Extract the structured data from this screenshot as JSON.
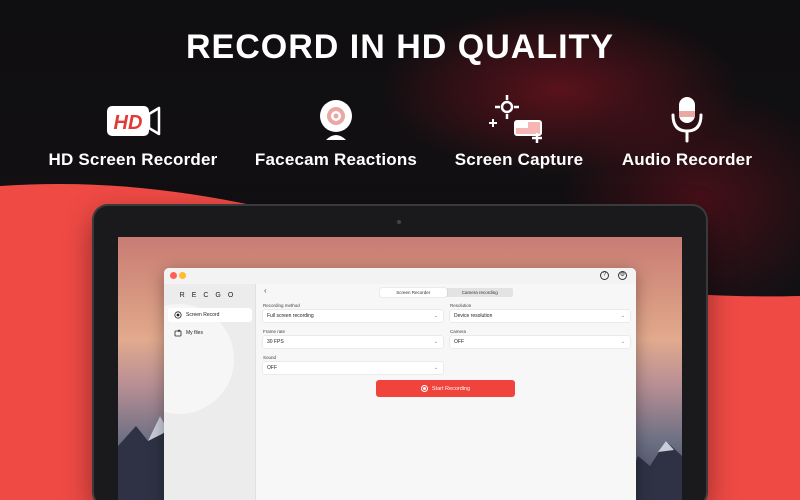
{
  "headline": "RECORD IN HD QUALITY",
  "features": [
    {
      "label": "HD Screen Recorder",
      "icon": "hd-camera-icon"
    },
    {
      "label": "Facecam Reactions",
      "icon": "webcam-icon"
    },
    {
      "label": "Screen Capture",
      "icon": "screen-capture-icon"
    },
    {
      "label": "Audio Recorder",
      "icon": "microphone-icon"
    }
  ],
  "hd_icon_text": "HD",
  "colors": {
    "accent": "#f0433b",
    "background": "#111111",
    "accent_soft": "#f6b6b3"
  },
  "app": {
    "logo": "RECGO",
    "sidebar": [
      {
        "label": "Screen Record",
        "icon": "record-icon",
        "active": true
      },
      {
        "label": "My files",
        "icon": "folder-icon",
        "active": false
      }
    ],
    "back_glyph": "‹",
    "tabs": [
      {
        "label": "Screen Recorder",
        "active": true
      },
      {
        "label": "Camera recording",
        "active": false
      }
    ],
    "fields": {
      "recording_method": {
        "label": "Recording method",
        "value": "Full screen recording"
      },
      "resolution": {
        "label": "Resolution",
        "value": "Device resolution"
      },
      "frame_rate": {
        "label": "Frame rate",
        "value": "30 FPS"
      },
      "camera": {
        "label": "Camera",
        "value": "OFF"
      },
      "sound": {
        "label": "Sound",
        "value": "OFF"
      }
    },
    "start_button": "Start Recording",
    "titlebar_icons": [
      "help-icon",
      "settings-icon"
    ]
  }
}
